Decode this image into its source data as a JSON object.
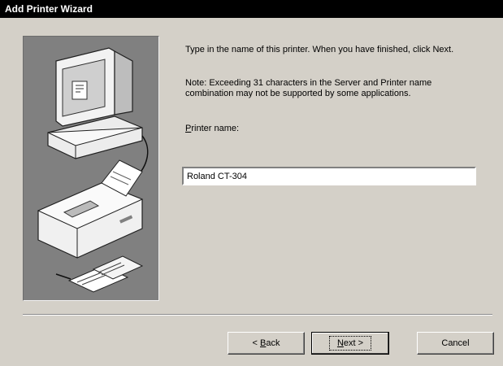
{
  "window": {
    "title": "Add Printer Wizard"
  },
  "content": {
    "instruction": "Type in the name of this printer.  When you have finished, click Next.",
    "note": "Note:  Exceeding 31 characters in the Server and Printer name combination may not be supported by some applications."
  },
  "printer_name": {
    "label_prefix": "",
    "label_mnemonic": "P",
    "label_rest": "rinter name:",
    "value": "Roland CT-304"
  },
  "buttons": {
    "back": {
      "pre": "< ",
      "mnemonic": "B",
      "rest": "ack"
    },
    "next": {
      "pre": "",
      "mnemonic": "N",
      "rest": "ext >"
    },
    "cancel": {
      "label": "Cancel"
    }
  },
  "colors": {
    "dialog_bg": "#d4d0c8",
    "titlebar_bg": "#000000",
    "illustration_bg": "#808080"
  }
}
